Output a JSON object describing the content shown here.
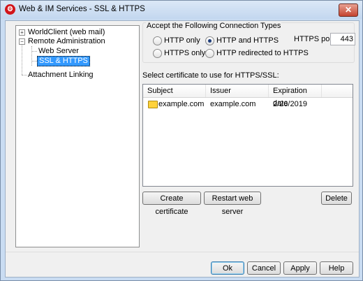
{
  "window": {
    "title": "Web & IM Services - SSL & HTTPS",
    "close_label": "✕"
  },
  "tree": {
    "items": [
      {
        "label": "WorldClient (web mail)",
        "expander": "+"
      },
      {
        "label": "Remote Administration",
        "expander": "−"
      },
      {
        "label": "Web Server"
      },
      {
        "label": "SSL & HTTPS",
        "selected": true
      },
      {
        "label": "Attachment Linking"
      }
    ]
  },
  "connection": {
    "group_title": "Accept the Following Connection Types",
    "options": [
      {
        "label": "HTTP only",
        "selected": false
      },
      {
        "label": "HTTP and HTTPS",
        "selected": true
      },
      {
        "label": "HTTPS only",
        "selected": false
      },
      {
        "label": "HTTP redirected to HTTPS",
        "selected": false
      }
    ],
    "port_label": "HTTPS port",
    "port_value": "443"
  },
  "certificates": {
    "label": "Select certificate to use for HTTPS/SSL:",
    "columns": [
      "Subject",
      "Issuer",
      "Expiration date"
    ],
    "rows": [
      {
        "subject": "example.com",
        "issuer": "example.com",
        "expiration": "2/26/2019"
      }
    ]
  },
  "actions": {
    "create": "Create certificate",
    "restart": "Restart web server",
    "delete": "Delete"
  },
  "dialog": {
    "ok": "Ok",
    "cancel": "Cancel",
    "apply": "Apply",
    "help": "Help"
  }
}
